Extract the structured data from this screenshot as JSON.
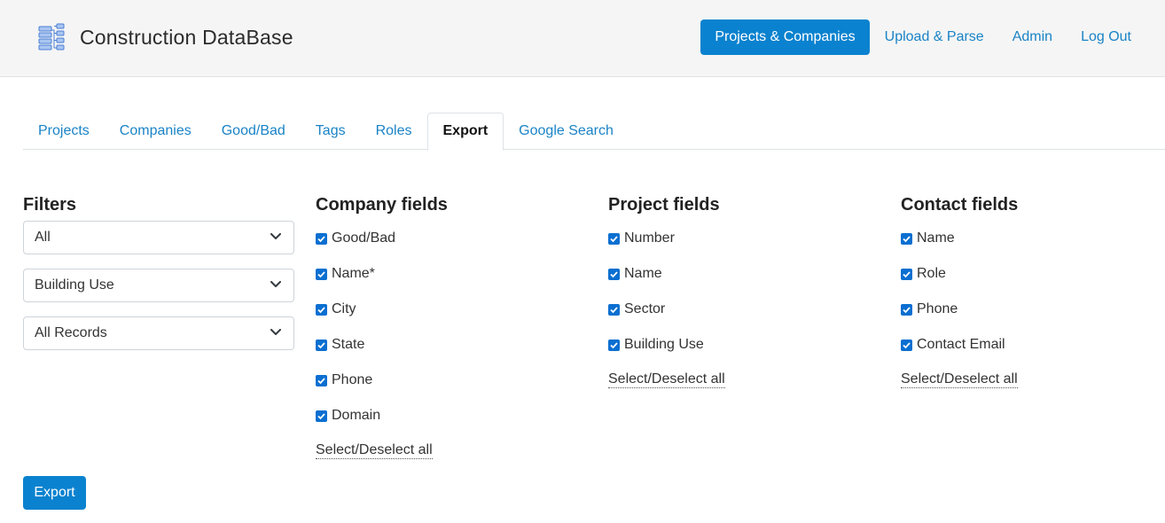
{
  "app": {
    "title": "Construction DataBase",
    "brand_icon": "database-sitemap-icon",
    "accent": "#0a82cf",
    "link": "#1a83c6"
  },
  "nav": [
    {
      "label": "Projects & Companies",
      "active": true
    },
    {
      "label": "Upload & Parse"
    },
    {
      "label": "Admin"
    },
    {
      "label": "Log Out"
    }
  ],
  "tabs": [
    {
      "label": "Projects"
    },
    {
      "label": "Companies"
    },
    {
      "label": "Good/Bad"
    },
    {
      "label": "Tags"
    },
    {
      "label": "Roles"
    },
    {
      "label": "Export",
      "active": true
    },
    {
      "label": "Google Search"
    }
  ],
  "filters": {
    "heading": "Filters",
    "selects": [
      {
        "value": "All",
        "icon": "chevron-down-icon"
      },
      {
        "value": "Building Use",
        "icon": "chevron-down-icon"
      },
      {
        "value": "All Records",
        "icon": "chevron-down-icon"
      }
    ]
  },
  "company_fields": {
    "heading": "Company fields",
    "items": [
      {
        "label": "Good/Bad",
        "checked": true
      },
      {
        "label": "Name*",
        "checked": true
      },
      {
        "label": "City",
        "checked": true
      },
      {
        "label": "State",
        "checked": true
      },
      {
        "label": "Phone",
        "checked": true
      },
      {
        "label": "Domain",
        "checked": true
      }
    ],
    "select_all": "Select/Deselect all"
  },
  "project_fields": {
    "heading": "Project fields",
    "items": [
      {
        "label": "Number",
        "checked": true
      },
      {
        "label": "Name",
        "checked": true
      },
      {
        "label": "Sector",
        "checked": true
      },
      {
        "label": "Building Use",
        "checked": true
      }
    ],
    "select_all": "Select/Deselect all"
  },
  "contact_fields": {
    "heading": "Contact fields",
    "items": [
      {
        "label": "Name",
        "checked": true
      },
      {
        "label": "Role",
        "checked": true
      },
      {
        "label": "Phone",
        "checked": true
      },
      {
        "label": "Contact Email",
        "checked": true
      }
    ],
    "select_all": "Select/Deselect all"
  },
  "actions": {
    "export_label": "Export"
  }
}
